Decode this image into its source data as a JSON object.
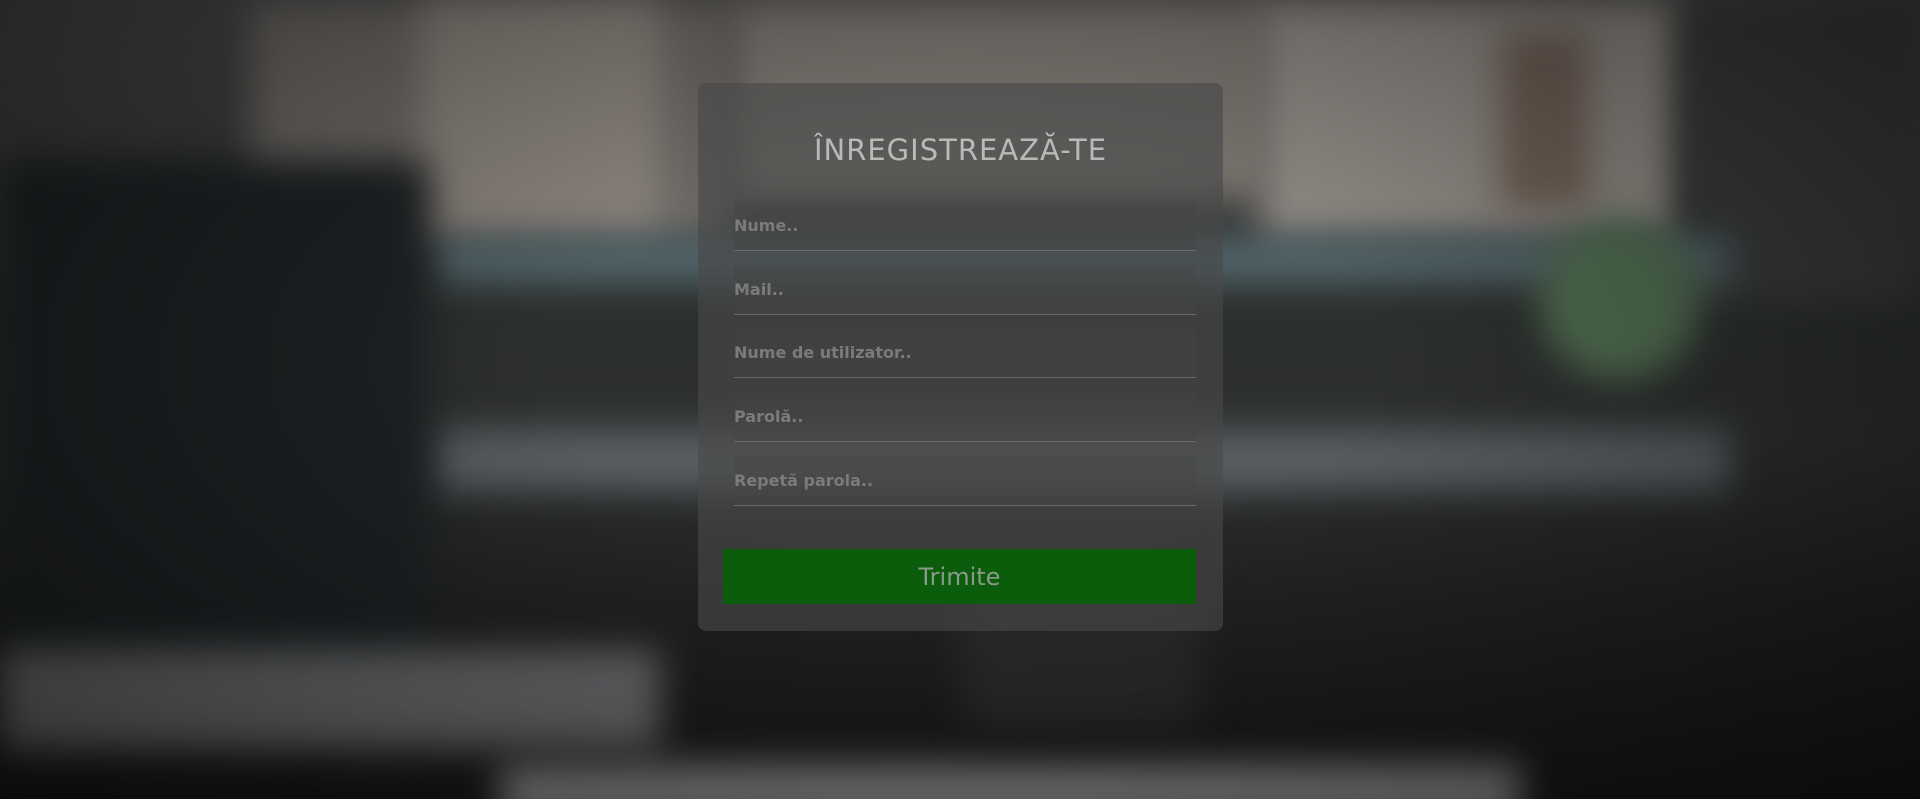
{
  "form": {
    "title": "ÎNREGISTREAZĂ-TE",
    "fields": [
      {
        "placeholder": "Nume.."
      },
      {
        "placeholder": "Mail.."
      },
      {
        "placeholder": "Nume de utilizator.."
      },
      {
        "placeholder": "Parolă.."
      },
      {
        "placeholder": "Repetă parola.."
      }
    ],
    "submit_label": "Trimite"
  },
  "colors": {
    "submit_background": "#0b5c0b",
    "card_background": "#484848",
    "title_text": "#b9b9b9",
    "placeholder_text": "#7b7b7b"
  }
}
